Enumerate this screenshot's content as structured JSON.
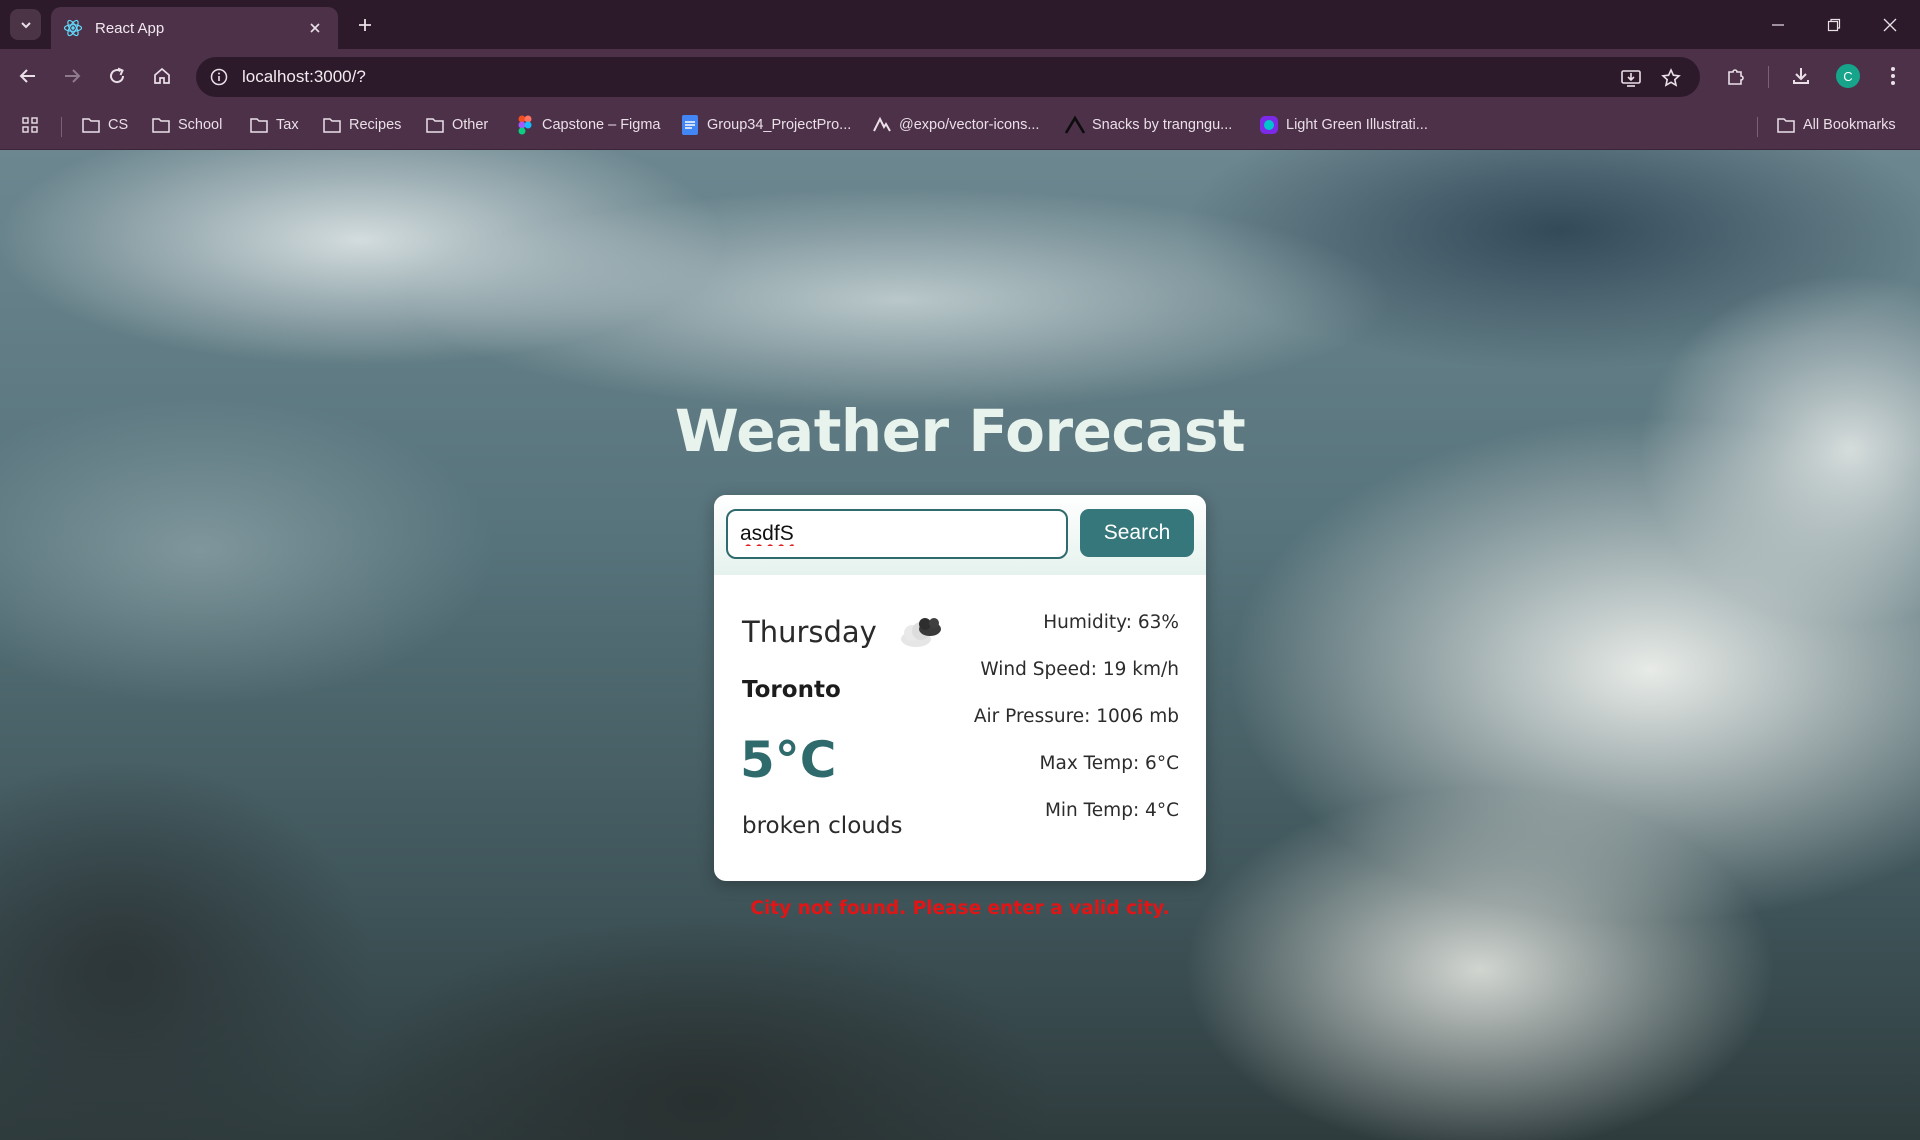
{
  "browser": {
    "tab_title": "React App",
    "url": "localhost:3000/?",
    "profile_initial": "C",
    "bookmarks": [
      {
        "label": "CS",
        "icon": "folder-icon"
      },
      {
        "label": "School",
        "icon": "folder-icon"
      },
      {
        "label": "Tax",
        "icon": "folder-icon"
      },
      {
        "label": "Recipes",
        "icon": "folder-icon"
      },
      {
        "label": "Other",
        "icon": "folder-icon"
      },
      {
        "label": "Capstone – Figma",
        "icon": "figma-icon"
      },
      {
        "label": "Group34_ProjectPro...",
        "icon": "google-docs-icon"
      },
      {
        "label": "@expo/vector-icons...",
        "icon": "expo-icon"
      },
      {
        "label": "Snacks by trangngu...",
        "icon": "expo-snack-icon"
      },
      {
        "label": "Light Green Illustrati...",
        "icon": "canva-icon"
      }
    ],
    "all_bookmarks": "All Bookmarks"
  },
  "app": {
    "title": "Weather Forecast",
    "search": {
      "value": "asdfS",
      "button_label": "Search"
    },
    "weather": {
      "day": "Thursday",
      "icon": "broken-clouds-icon",
      "city": "Toronto",
      "temperature": "5°C",
      "description": "broken clouds",
      "humidity": "Humidity: 63%",
      "wind_speed": "Wind Speed: 19 km/h",
      "air_pressure": "Air Pressure: 1006 mb",
      "max_temp": "Max Temp: 6°C",
      "min_temp": "Min Temp: 4°C"
    },
    "error": "City not found. Please enter a valid city."
  },
  "colors": {
    "accent": "#35777a",
    "temperature": "#2f6b6c",
    "title": "#e7f3ec",
    "error": "#e11515",
    "chrome": "#4d3149"
  }
}
